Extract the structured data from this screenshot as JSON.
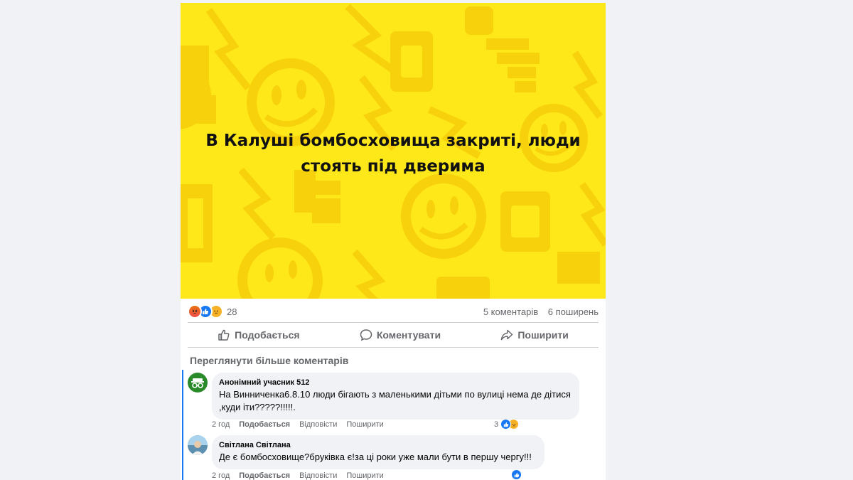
{
  "post": {
    "headline": "В Калуші бомбосховища закриті, люди стоять під дверима",
    "reaction_icons": [
      "angry-icon",
      "like-icon",
      "sad-icon"
    ],
    "reaction_count": "28",
    "comments_count": "5 коментарів",
    "shares_count": "6 поширень",
    "background_color": "#ffe81a"
  },
  "actions": {
    "like": "Подобається",
    "comment": "Коментувати",
    "share": "Поширити"
  },
  "comments_section": {
    "view_more": "Переглянути більше коментарів"
  },
  "comments": [
    {
      "author": "Анонімний учасник 512",
      "text": "На Винниченка6.8.10 люди бігають з маленькими дітьми по вулиці нема де дітися ,куди іти?????!!!!!.",
      "time": "2 год",
      "like": "Подобається",
      "reply": "Відповісти",
      "share": "Поширити",
      "reactions_count": "3",
      "avatar_icon": "anonymous-icon",
      "avatar_color": "#2a8a2a"
    },
    {
      "author": "Світлана Світлана",
      "text": "Де є бомбосховище?бруківка є!за ці роки уже мали бути в першу чергу!!!",
      "time": "2 год",
      "like": "Подобається",
      "reply": "Відповісти",
      "share": "Поширити",
      "avatar_icon": "profile-photo-icon"
    }
  ],
  "colors": {
    "accent": "#1877f2",
    "muted_text": "#65676b",
    "bubble": "#f0f2f5"
  }
}
